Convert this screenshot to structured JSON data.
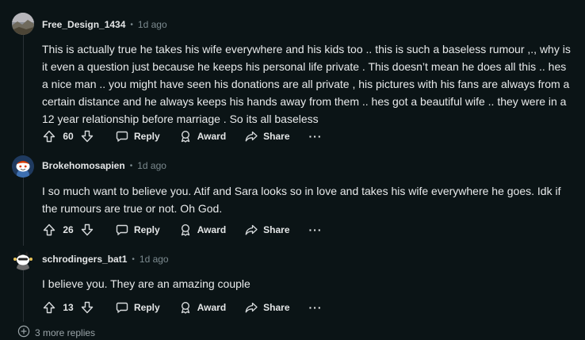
{
  "comments": [
    {
      "author": "Free_Design_1434",
      "time": "1d ago",
      "text": "This is actually true he takes his wife everywhere and his kids too .. this is such a baseless rumour ,., why is it even a question just because he keeps his personal life private . This doesn’t mean he does all this .. hes a nice man .. you might have seen his donations are all private , his pictures with his fans are always from a certain distance and he always keeps his hands away from them .. hes got a beautiful wife .. they were in a 12 year relationship before marriage . So its all baseless",
      "votes": "60",
      "avatar_icon": "landscape-avatar-icon"
    },
    {
      "author": "Brokehomosapien",
      "time": "1d ago",
      "text": "I so much want to believe you. Atif and Sara looks so in love and takes his wife everywhere he goes. Idk if the rumours are true or not. Oh God.",
      "votes": "26",
      "avatar_icon": "snoo-avatar-icon"
    },
    {
      "author": "schrodingers_bat1",
      "time": "1d ago",
      "text": "I believe you. They are an amazing couple",
      "votes": "13",
      "avatar_icon": "snoo-avatar-icon"
    }
  ],
  "actions": {
    "reply": "Reply",
    "award": "Award",
    "share": "Share",
    "more": "···"
  },
  "more_replies": "3 more replies",
  "meta_separator": "•",
  "colors": {
    "background": "#0b1416",
    "text": "#e8eaeb",
    "meta": "#7c8a8f"
  }
}
